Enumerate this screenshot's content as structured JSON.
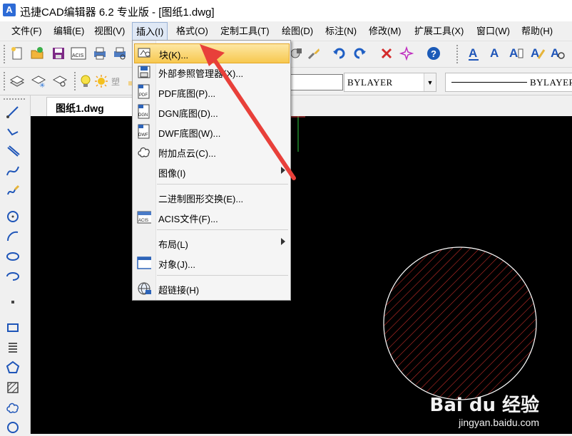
{
  "window": {
    "logo_letter": "A",
    "title": "迅捷CAD编辑器 6.2 专业版  - [图纸1.dwg]"
  },
  "menu": [
    {
      "label": "文件(F)"
    },
    {
      "label": "编辑(E)"
    },
    {
      "label": "视图(V)"
    },
    {
      "label": "插入(I)",
      "active": true
    },
    {
      "label": "格式(O)"
    },
    {
      "label": "定制工具(T)"
    },
    {
      "label": "绘图(D)"
    },
    {
      "label": "标注(N)"
    },
    {
      "label": "修改(M)"
    },
    {
      "label": "扩展工具(X)"
    },
    {
      "label": "窗口(W)"
    },
    {
      "label": "帮助(H)"
    }
  ],
  "toolbar2": {
    "color_combo": "BYLAYER",
    "linetype_combo": "BYLAYER"
  },
  "tabs": [
    {
      "label": "图纸1.dwg",
      "close": "✕"
    }
  ],
  "insert_menu": {
    "items": [
      {
        "label": "块(K)...",
        "icon": "block-icon",
        "highlighted": true
      },
      {
        "label": "外部参照管理器(X)...",
        "icon": "xref-manager-icon"
      },
      {
        "label": "PDF底图(P)...",
        "icon": "pdf-underlay-icon",
        "icon_text": "PDF"
      },
      {
        "label": "DGN底图(D)...",
        "icon": "dgn-underlay-icon",
        "icon_text": "DGN"
      },
      {
        "label": "DWF底图(W)...",
        "icon": "dwf-underlay-icon",
        "icon_text": "DWF"
      },
      {
        "label": "附加点云(C)...",
        "icon": "point-cloud-icon"
      },
      {
        "label": "图像(I)",
        "icon": "",
        "submenu": true
      },
      {
        "label": "二进制图形交换(E)...",
        "icon": ""
      },
      {
        "label": "ACIS文件(F)...",
        "icon": "acis-file-icon",
        "icon_text": "ACIS"
      },
      {
        "label": "布局(L)",
        "icon": "",
        "submenu": true
      },
      {
        "label": "对象(J)...",
        "icon": "ole-object-icon"
      },
      {
        "label": "超链接(H)",
        "icon": "hyperlink-icon"
      }
    ]
  },
  "watermark": {
    "logo": "Bai du 经验",
    "url": "jingyan.baidu.com"
  },
  "colors": {
    "canvas": "#000000",
    "hatch": "#d0302a",
    "circle_outline": "#ffffff",
    "arrow": "#e8403a",
    "menu_highlight": "#f7c84f"
  }
}
